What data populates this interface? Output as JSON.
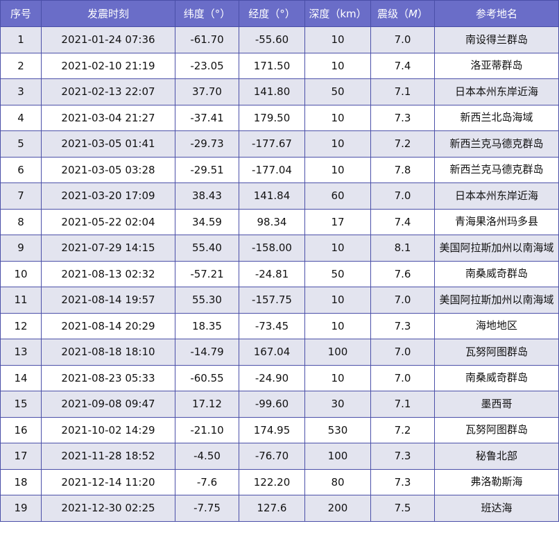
{
  "table": {
    "headers": {
      "index": "序号",
      "time": "发震时刻",
      "latitude": "纬度（°）",
      "longitude": "经度（°）",
      "depth": "深度（km）",
      "magnitude_prefix": "震级（",
      "magnitude_unit": "M",
      "magnitude_suffix": "）",
      "place": "参考地名"
    },
    "rows": [
      {
        "index": "1",
        "time": "2021-01-24 07:36",
        "latitude": "-61.70",
        "longitude": "-55.60",
        "depth": "10",
        "magnitude": "7.0",
        "place": "南设得兰群岛"
      },
      {
        "index": "2",
        "time": "2021-02-10 21:19",
        "latitude": "-23.05",
        "longitude": "171.50",
        "depth": "10",
        "magnitude": "7.4",
        "place": "洛亚蒂群岛"
      },
      {
        "index": "3",
        "time": "2021-02-13 22:07",
        "latitude": "37.70",
        "longitude": "141.80",
        "depth": "50",
        "magnitude": "7.1",
        "place": "日本本州东岸近海"
      },
      {
        "index": "4",
        "time": "2021-03-04 21:27",
        "latitude": "-37.41",
        "longitude": "179.50",
        "depth": "10",
        "magnitude": "7.3",
        "place": "新西兰北岛海域"
      },
      {
        "index": "5",
        "time": "2021-03-05 01:41",
        "latitude": "-29.73",
        "longitude": "-177.67",
        "depth": "10",
        "magnitude": "7.2",
        "place": "新西兰克马德克群岛"
      },
      {
        "index": "6",
        "time": "2021-03-05 03:28",
        "latitude": "-29.51",
        "longitude": "-177.04",
        "depth": "10",
        "magnitude": "7.8",
        "place": "新西兰克马德克群岛"
      },
      {
        "index": "7",
        "time": "2021-03-20 17:09",
        "latitude": "38.43",
        "longitude": "141.84",
        "depth": "60",
        "magnitude": "7.0",
        "place": "日本本州东岸近海"
      },
      {
        "index": "8",
        "time": "2021-05-22 02:04",
        "latitude": "34.59",
        "longitude": "98.34",
        "depth": "17",
        "magnitude": "7.4",
        "place": "青海果洛州玛多县"
      },
      {
        "index": "9",
        "time": "2021-07-29 14:15",
        "latitude": "55.40",
        "longitude": "-158.00",
        "depth": "10",
        "magnitude": "8.1",
        "place": "美国阿拉斯加州以南海域"
      },
      {
        "index": "10",
        "time": "2021-08-13 02:32",
        "latitude": "-57.21",
        "longitude": "-24.81",
        "depth": "50",
        "magnitude": "7.6",
        "place": "南桑威奇群岛"
      },
      {
        "index": "11",
        "time": "2021-08-14 19:57",
        "latitude": "55.30",
        "longitude": "-157.75",
        "depth": "10",
        "magnitude": "7.0",
        "place": "美国阿拉斯加州以南海域"
      },
      {
        "index": "12",
        "time": "2021-08-14 20:29",
        "latitude": "18.35",
        "longitude": "-73.45",
        "depth": "10",
        "magnitude": "7.3",
        "place": "海地地区"
      },
      {
        "index": "13",
        "time": "2021-08-18 18:10",
        "latitude": "-14.79",
        "longitude": "167.04",
        "depth": "100",
        "magnitude": "7.0",
        "place": "瓦努阿图群岛"
      },
      {
        "index": "14",
        "time": "2021-08-23 05:33",
        "latitude": "-60.55",
        "longitude": "-24.90",
        "depth": "10",
        "magnitude": "7.0",
        "place": "南桑威奇群岛"
      },
      {
        "index": "15",
        "time": "2021-09-08 09:47",
        "latitude": "17.12",
        "longitude": "-99.60",
        "depth": "30",
        "magnitude": "7.1",
        "place": "墨西哥"
      },
      {
        "index": "16",
        "time": "2021-10-02 14:29",
        "latitude": "-21.10",
        "longitude": "174.95",
        "depth": "530",
        "magnitude": "7.2",
        "place": "瓦努阿图群岛"
      },
      {
        "index": "17",
        "time": "2021-11-28 18:52",
        "latitude": "-4.50",
        "longitude": "-76.70",
        "depth": "100",
        "magnitude": "7.3",
        "place": "秘鲁北部"
      },
      {
        "index": "18",
        "time": "2021-12-14 11:20",
        "latitude": "-7.6",
        "longitude": "122.20",
        "depth": "80",
        "magnitude": "7.3",
        "place": "弗洛勒斯海"
      },
      {
        "index": "19",
        "time": "2021-12-30 02:25",
        "latitude": "-7.75",
        "longitude": "127.6",
        "depth": "200",
        "magnitude": "7.5",
        "place": "班达海"
      }
    ]
  },
  "colors": {
    "header_background": "#6a6dc8",
    "header_text": "#ffffff",
    "shaded_row": "#e3e4ef",
    "plain_row": "#ffffff",
    "border": "#4a4fa8"
  }
}
